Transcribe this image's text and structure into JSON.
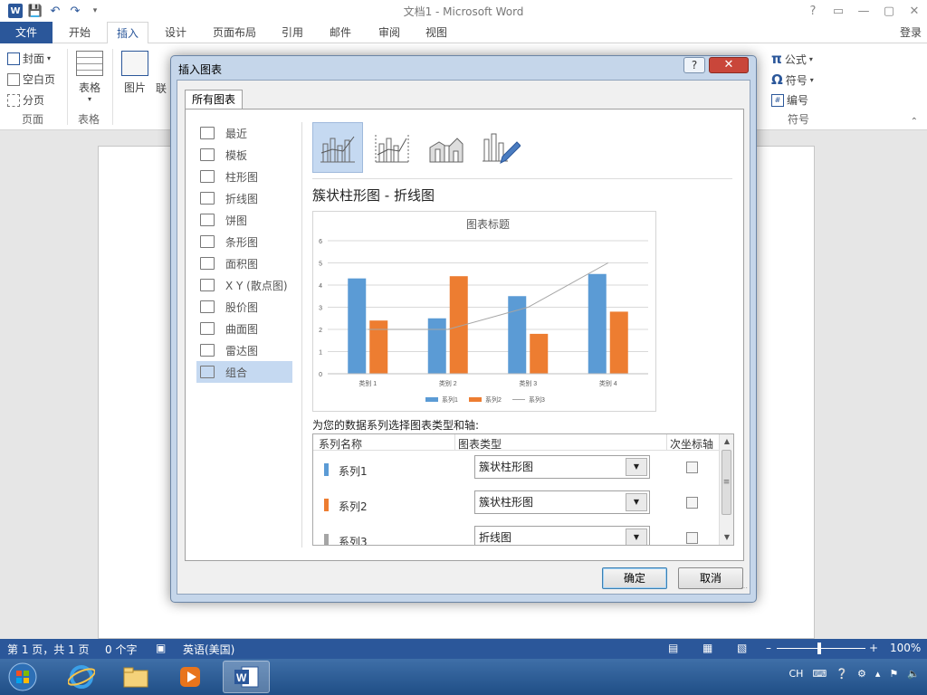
{
  "window": {
    "title": "文档1 - Microsoft Word",
    "controls": {
      "help": "?",
      "restore": "▭",
      "minimize": "—",
      "maximize": "▢",
      "close": "✕"
    },
    "login": "登录"
  },
  "ribbon_tabs": [
    "文件",
    "开始",
    "插入",
    "设计",
    "页面布局",
    "引用",
    "邮件",
    "审阅",
    "视图"
  ],
  "ribbon": {
    "pages_group": {
      "cover": "封面",
      "blank": "空白页",
      "break": "分页",
      "label": "页面"
    },
    "table_group": {
      "table": "表格",
      "label": "表格"
    },
    "picture": "图片",
    "link": "联",
    "symbols_group": {
      "equation": "公式",
      "symbol": "符号",
      "number": "编号",
      "label": "符号"
    }
  },
  "dialog": {
    "title": "插入图表",
    "help": "?",
    "close": "✕",
    "tab": "所有图表",
    "categories": [
      {
        "label": "最近",
        "icon": "recent-icon"
      },
      {
        "label": "模板",
        "icon": "folder-icon"
      },
      {
        "label": "柱形图",
        "icon": "column-chart-icon"
      },
      {
        "label": "折线图",
        "icon": "line-chart-icon"
      },
      {
        "label": "饼图",
        "icon": "pie-chart-icon"
      },
      {
        "label": "条形图",
        "icon": "bar-chart-icon"
      },
      {
        "label": "面积图",
        "icon": "area-chart-icon"
      },
      {
        "label": "X Y (散点图)",
        "icon": "scatter-chart-icon"
      },
      {
        "label": "股价图",
        "icon": "stock-chart-icon"
      },
      {
        "label": "曲面图",
        "icon": "surface-chart-icon"
      },
      {
        "label": "雷达图",
        "icon": "radar-chart-icon"
      },
      {
        "label": "组合",
        "icon": "combo-chart-icon"
      }
    ],
    "selected_category_index": 11,
    "combo_title": "簇状柱形图 - 折线图",
    "choose_label": "为您的数据系列选择图表类型和轴:",
    "table_headers": {
      "name": "系列名称",
      "type": "图表类型",
      "secondary": "次坐标轴"
    },
    "series_rows": [
      {
        "name": "系列1",
        "type": "簇状柱形图",
        "color": "#5b9bd5",
        "secondary": false
      },
      {
        "name": "系列2",
        "type": "簇状柱形图",
        "color": "#ed7d31",
        "secondary": false
      },
      {
        "name": "系列3",
        "type": "折线图",
        "color": "#a5a5a5",
        "secondary": false
      }
    ],
    "ok": "确定",
    "cancel": "取消"
  },
  "chart_data": {
    "type": "bar",
    "title": "图表标题",
    "categories": [
      "类别 1",
      "类别 2",
      "类别 3",
      "类别 4"
    ],
    "series": [
      {
        "name": "系列1",
        "kind": "bar",
        "color": "#5b9bd5",
        "values": [
          4.3,
          2.5,
          3.5,
          4.5
        ]
      },
      {
        "name": "系列2",
        "kind": "bar",
        "color": "#ed7d31",
        "values": [
          2.4,
          4.4,
          1.8,
          2.8
        ]
      },
      {
        "name": "系列3",
        "kind": "line",
        "color": "#a5a5a5",
        "values": [
          2,
          2,
          3,
          5
        ]
      }
    ],
    "ylim": [
      0,
      6
    ],
    "yticks": [
      "0",
      "1",
      "2",
      "3",
      "4",
      "5",
      "6"
    ],
    "grid": true,
    "legend": "bottom"
  },
  "statusbar": {
    "page": "第 1 页，共 1 页",
    "words": "0 个字",
    "lang": "英语(美国)",
    "zoom": "100%"
  },
  "tray": {
    "ime": "CH"
  }
}
